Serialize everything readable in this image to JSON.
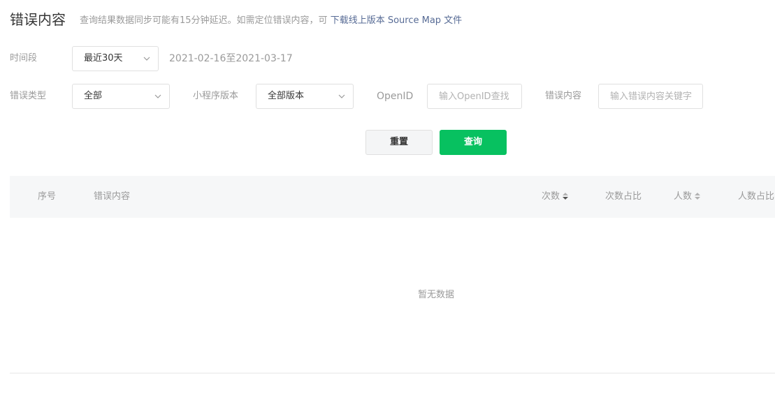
{
  "header": {
    "title": "错误内容",
    "notice": "查询结果数据同步可能有15分钟延迟。如需定位错误内容，可",
    "link": "下载线上版本 Source Map 文件"
  },
  "filters": {
    "period_label": "时间段",
    "period_value": "最近30天",
    "date_range": "2021-02-16至2021-03-17",
    "error_type_label": "错误类型",
    "error_type_value": "全部",
    "version_label": "小程序版本",
    "version_value": "全部版本",
    "openid_label": "OpenID",
    "openid_placeholder": "输入OpenID查找",
    "error_content_label": "错误内容",
    "error_content_placeholder": "输入错误内容关键字"
  },
  "buttons": {
    "reset": "重置",
    "query": "查询"
  },
  "table": {
    "columns": [
      "序号",
      "错误内容",
      "次数",
      "次数占比",
      "人数",
      "人数占比"
    ],
    "rows": [],
    "empty_text": "暂无数据"
  },
  "colors": {
    "primary": "#07c160",
    "link": "#576b95",
    "muted_text": "#9a9a9a",
    "header_bg": "#f6f7f8"
  }
}
